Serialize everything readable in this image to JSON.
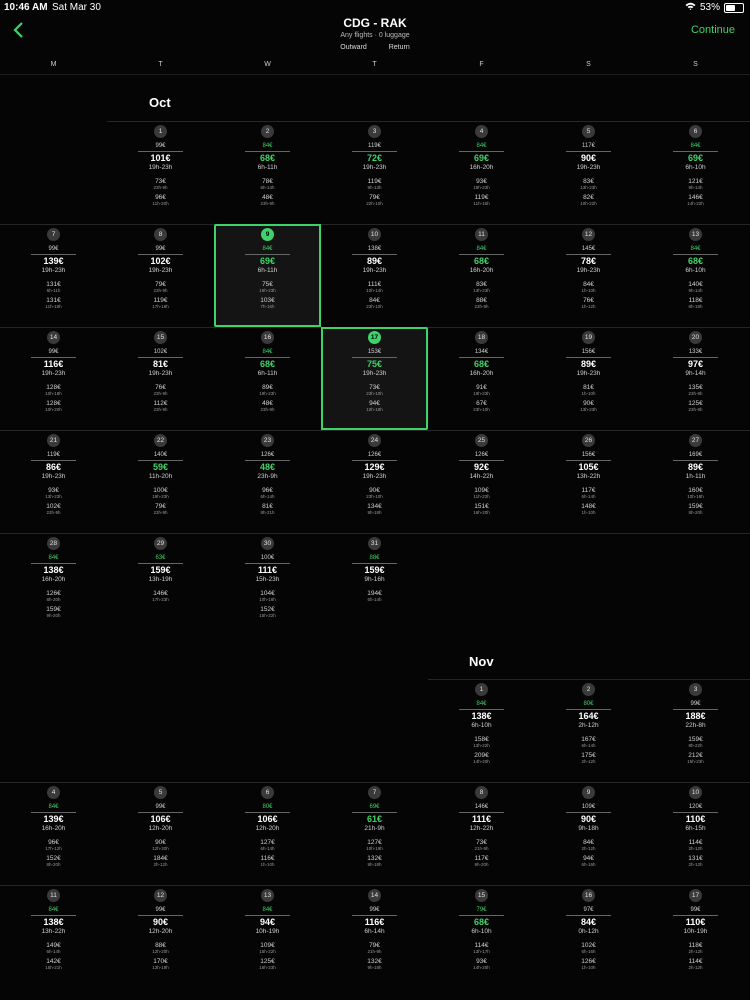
{
  "status": {
    "time": "10:46 AM",
    "date": "Sat Mar 30",
    "battery": "53%"
  },
  "header": {
    "title": "CDG - RAK",
    "subtitle": "Any flights · 0 luggage",
    "tab_outward": "Outward",
    "tab_return": "Return",
    "continue": "Continue"
  },
  "weekdays": [
    "M",
    "T",
    "W",
    "T",
    "F",
    "S",
    "S"
  ],
  "accent": "#3fd26b",
  "months": [
    {
      "name": "Oct",
      "days": [
        {
          "d": "1",
          "p1": "99€",
          "pm": "101€",
          "t1": "19h-23h",
          "p2": "73€",
          "t2": "23h-9h",
          "p3": "96€",
          "t3": "11h-20h"
        },
        {
          "d": "2",
          "p1": "84€",
          "pm": "68€",
          "t1": "6h-11h",
          "p2": "78€",
          "t2": "6h-14h",
          "p3": "48€",
          "t3": "23h-9h",
          "g1": true,
          "gm": true
        },
        {
          "d": "3",
          "p1": "119€",
          "pm": "72€",
          "t1": "19h-23h",
          "p2": "119€",
          "t2": "9h-13h",
          "p3": "79€",
          "t3": "22h-10h",
          "gm": true
        },
        {
          "d": "4",
          "p1": "84€",
          "pm": "69€",
          "t1": "16h-20h",
          "p2": "93€",
          "t2": "18h-23h",
          "p3": "119€",
          "t3": "11h-16h",
          "g1": true,
          "gm": true
        },
        {
          "d": "5",
          "p1": "117€",
          "pm": "90€",
          "t1": "19h-23h",
          "p2": "83€",
          "t2": "13h-23h",
          "p3": "82€",
          "t3": "10h-22h"
        },
        {
          "d": "6",
          "p1": "84€",
          "pm": "69€",
          "t1": "6h-10h",
          "p2": "121€",
          "t2": "9h-14h",
          "p3": "146€",
          "t3": "14h-22h",
          "g1": true,
          "gm": true
        },
        {
          "d": "7",
          "p1": "99€",
          "pm": "139€",
          "t1": "19h-23h",
          "p2": "131€",
          "t2": "5h-11h",
          "p3": "131€",
          "t3": "11h-18h"
        },
        {
          "d": "8",
          "p1": "99€",
          "pm": "102€",
          "t1": "19h-23h",
          "p2": "79€",
          "t2": "23h-9h",
          "p3": "119€",
          "t3": "17h-18h"
        },
        {
          "d": "9",
          "p1": "84€",
          "pm": "69€",
          "t1": "6h-11h",
          "p2": "75€",
          "t2": "19h-23h",
          "p3": "103€",
          "t3": "7h-16h",
          "g1": true,
          "gm": true,
          "sel": "l",
          "gd": true
        },
        {
          "d": "10",
          "p1": "138€",
          "pm": "89€",
          "t1": "19h-23h",
          "p2": "111€",
          "t2": "10h-14h",
          "p3": "84€",
          "t3": "23h-10h"
        },
        {
          "d": "11",
          "p1": "84€",
          "pm": "68€",
          "t1": "16h-20h",
          "p2": "83€",
          "t2": "13h-23h",
          "p3": "88€",
          "t3": "23h-9h",
          "g1": true,
          "gm": true
        },
        {
          "d": "12",
          "p1": "145€",
          "pm": "78€",
          "t1": "19h-23h",
          "p2": "84€",
          "t2": "1h-10h",
          "p3": "76€",
          "t3": "1h-12h"
        },
        {
          "d": "13",
          "p1": "84€",
          "pm": "68€",
          "t1": "6h-10h",
          "p2": "140€",
          "t2": "9h-14h",
          "p3": "118€",
          "t3": "8h-18h",
          "g1": true,
          "gm": true
        },
        {
          "d": "14",
          "p1": "99€",
          "pm": "116€",
          "t1": "19h-23h",
          "p2": "128€",
          "t2": "10h-18h",
          "p3": "128€",
          "t3": "10h-20h"
        },
        {
          "d": "15",
          "p1": "102€",
          "pm": "81€",
          "t1": "19h-23h",
          "p2": "76€",
          "t2": "23h-9h",
          "p3": "112€",
          "t3": "23h-9h"
        },
        {
          "d": "16",
          "p1": "84€",
          "pm": "68€",
          "t1": "6h-11h",
          "p2": "89€",
          "t2": "19h-23h",
          "p3": "48€",
          "t3": "23h-9h",
          "g1": true,
          "gm": true
        },
        {
          "d": "17",
          "p1": "153€",
          "pm": "75€",
          "t1": "19h-23h",
          "p2": "73€",
          "t2": "23h-10h",
          "p3": "94€",
          "t3": "10h-18h",
          "gm": true,
          "sel": "r",
          "gd": true
        },
        {
          "d": "18",
          "p1": "134€",
          "pm": "68€",
          "t1": "16h-20h",
          "p2": "91€",
          "t2": "19h-23h",
          "p3": "67€",
          "t3": "23h-10h",
          "gm": true
        },
        {
          "d": "19",
          "p1": "156€",
          "pm": "89€",
          "t1": "19h-23h",
          "p2": "81€",
          "t2": "1h-10h",
          "p3": "90€",
          "t3": "13h-23h"
        },
        {
          "d": "20",
          "p1": "133€",
          "pm": "97€",
          "t1": "9h-14h",
          "p2": "135€",
          "t2": "23h-9h",
          "p3": "125€",
          "t3": "23h-9h"
        },
        {
          "d": "21",
          "p1": "119€",
          "pm": "86€",
          "t1": "19h-23h",
          "p2": "93€",
          "t2": "13h-23h",
          "p3": "102€",
          "t3": "23h-9h"
        },
        {
          "d": "22",
          "p1": "140€",
          "pm": "59€",
          "t1": "11h-20h",
          "p2": "100€",
          "t2": "19h-23h",
          "p3": "79€",
          "t3": "23h-9h",
          "gm": true
        },
        {
          "d": "23",
          "p1": "126€",
          "pm": "48€",
          "t1": "23h-9h",
          "p2": "96€",
          "t2": "6h-14h",
          "p3": "81€",
          "t3": "8h-21h",
          "gm": true
        },
        {
          "d": "24",
          "p1": "126€",
          "pm": "129€",
          "t1": "19h-23h",
          "p2": "90€",
          "t2": "23h-10h",
          "p3": "134€",
          "t3": "9h-18h"
        },
        {
          "d": "25",
          "p1": "126€",
          "pm": "92€",
          "t1": "14h-22h",
          "p2": "109€",
          "t2": "11h-23h",
          "p3": "151€",
          "t3": "16h-20h"
        },
        {
          "d": "26",
          "p1": "156€",
          "pm": "105€",
          "t1": "13h-22h",
          "p2": "117€",
          "t2": "6h-14h",
          "p3": "148€",
          "t3": "1h-10h"
        },
        {
          "d": "27",
          "p1": "169€",
          "pm": "89€",
          "t1": "1h-11h",
          "p2": "160€",
          "t2": "10h-18h",
          "p3": "159€",
          "t3": "8h-20h"
        },
        {
          "d": "28",
          "p1": "84€",
          "pm": "138€",
          "t1": "16h-20h",
          "p2": "126€",
          "t2": "8h-20h",
          "p3": "159€",
          "t3": "9h-20h",
          "g1": true
        },
        {
          "d": "29",
          "p1": "63€",
          "pm": "159€",
          "t1": "13h-19h",
          "p2": "146€",
          "t2": "17h-23h",
          "p3": "",
          "t3": "",
          "g1": true
        },
        {
          "d": "30",
          "p1": "100€",
          "pm": "111€",
          "t1": "15h-23h",
          "p2": "104€",
          "t2": "10h-18h",
          "p3": "152€",
          "t3": "15h-22h"
        },
        {
          "d": "31",
          "p1": "88€",
          "pm": "159€",
          "t1": "9h-16h",
          "p2": "194€",
          "t2": "6h-14h",
          "p3": "",
          "t3": "",
          "g1": true
        }
      ]
    },
    {
      "name": "Nov",
      "days": [
        {
          "d": "1",
          "p1": "84€",
          "pm": "138€",
          "t1": "6h-10h",
          "p2": "158€",
          "t2": "13h-22h",
          "p3": "209€",
          "t3": "14h-20h",
          "g1": true
        },
        {
          "d": "2",
          "p1": "80€",
          "pm": "164€",
          "t1": "2h-12h",
          "p2": "167€",
          "t2": "6h-14h",
          "p3": "175€",
          "t3": "2h-12h",
          "g1": true
        },
        {
          "d": "3",
          "p1": "99€",
          "pm": "188€",
          "t1": "22h-8h",
          "p2": "159€",
          "t2": "8h-22h",
          "p3": "212€",
          "t3": "15h-23h"
        },
        {
          "d": "4",
          "p1": "84€",
          "pm": "139€",
          "t1": "16h-20h",
          "p2": "96€",
          "t2": "17h-12h",
          "p3": "152€",
          "t3": "8h-20h",
          "g1": true
        },
        {
          "d": "5",
          "p1": "99€",
          "pm": "106€",
          "t1": "12h-20h",
          "p2": "90€",
          "t2": "12h-20h",
          "p3": "184€",
          "t3": "2h-12h"
        },
        {
          "d": "6",
          "p1": "80€",
          "pm": "106€",
          "t1": "12h-20h",
          "p2": "127€",
          "t2": "6h-14h",
          "p3": "116€",
          "t3": "1h-10h",
          "g1": true
        },
        {
          "d": "7",
          "p1": "69€",
          "pm": "61€",
          "t1": "21h-9h",
          "p2": "127€",
          "t2": "10h-19h",
          "p3": "132€",
          "t3": "9h-18h",
          "g1": true,
          "gm": true
        },
        {
          "d": "8",
          "p1": "146€",
          "pm": "111€",
          "t1": "12h-22h",
          "p2": "73€",
          "t2": "21h-9h",
          "p3": "117€",
          "t3": "9h-20h"
        },
        {
          "d": "9",
          "p1": "109€",
          "pm": "90€",
          "t1": "9h-18h",
          "p2": "84€",
          "t2": "2h-12h",
          "p3": "94€",
          "t3": "6h-16h"
        },
        {
          "d": "10",
          "p1": "120€",
          "pm": "110€",
          "t1": "6h-15h",
          "p2": "114€",
          "t2": "2h-12h",
          "p3": "131€",
          "t3": "2h-12h"
        },
        {
          "d": "11",
          "p1": "84€",
          "pm": "138€",
          "t1": "13h-22h",
          "p2": "149€",
          "t2": "6h-14h",
          "p3": "142€",
          "t3": "15h-21h",
          "g1": true
        },
        {
          "d": "12",
          "p1": "99€",
          "pm": "90€",
          "t1": "12h-20h",
          "p2": "88€",
          "t2": "12h-20h",
          "p3": "170€",
          "t3": "13h-19h"
        },
        {
          "d": "13",
          "p1": "84€",
          "pm": "94€",
          "t1": "10h-19h",
          "p2": "109€",
          "t2": "15h-22h",
          "p3": "125€",
          "t3": "16h-23h",
          "g1": true
        },
        {
          "d": "14",
          "p1": "99€",
          "pm": "116€",
          "t1": "6h-14h",
          "p2": "79€",
          "t2": "21h-9h",
          "p3": "132€",
          "t3": "9h-18h"
        },
        {
          "d": "15",
          "p1": "79€",
          "pm": "68€",
          "t1": "6h-10h",
          "p2": "114€",
          "t2": "13h-17h",
          "p3": "93€",
          "t3": "14h-20h",
          "g1": true,
          "gm": true
        },
        {
          "d": "16",
          "p1": "97€",
          "pm": "84€",
          "t1": "0h-12h",
          "p2": "102€",
          "t2": "6h-16h",
          "p3": "126€",
          "t3": "1h-10h"
        },
        {
          "d": "17",
          "p1": "99€",
          "pm": "110€",
          "t1": "10h-19h",
          "p2": "118€",
          "t2": "2h-12h",
          "p3": "114€",
          "t3": "2h-12h"
        }
      ]
    }
  ]
}
